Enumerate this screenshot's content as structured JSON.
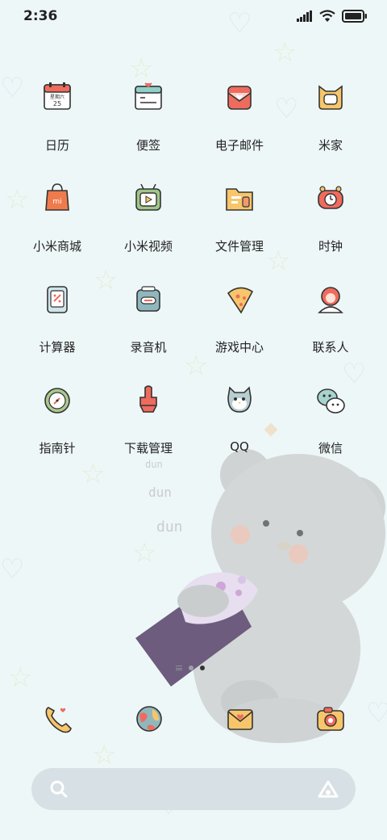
{
  "status_bar": {
    "time": "2:36",
    "icons": [
      "signal-icon",
      "wifi-icon",
      "battery-icon"
    ]
  },
  "apps": [
    {
      "label": "日历",
      "icon": "calendar-icon",
      "calendar_weekday": "星期六",
      "calendar_day": "25"
    },
    {
      "label": "便签",
      "icon": "notes-icon"
    },
    {
      "label": "电子邮件",
      "icon": "email-icon"
    },
    {
      "label": "米家",
      "icon": "mijia-icon"
    },
    {
      "label": "小米商城",
      "icon": "mi-store-icon"
    },
    {
      "label": "小米视频",
      "icon": "mi-video-icon"
    },
    {
      "label": "文件管理",
      "icon": "file-manager-icon"
    },
    {
      "label": "时钟",
      "icon": "clock-icon"
    },
    {
      "label": "计算器",
      "icon": "calculator-icon"
    },
    {
      "label": "录音机",
      "icon": "recorder-icon"
    },
    {
      "label": "游戏中心",
      "icon": "game-center-icon"
    },
    {
      "label": "联系人",
      "icon": "contacts-icon"
    },
    {
      "label": "指南针",
      "icon": "compass-icon"
    },
    {
      "label": "下载管理",
      "icon": "downloads-icon"
    },
    {
      "label": "QQ",
      "icon": "qq-icon"
    },
    {
      "label": "微信",
      "icon": "wechat-icon"
    }
  ],
  "wallpaper_text": [
    "dun",
    "dun",
    "dun"
  ],
  "page_indicator": {
    "pages": 2,
    "current": 2
  },
  "dock": [
    {
      "icon": "phone-icon"
    },
    {
      "icon": "browser-icon"
    },
    {
      "icon": "messages-icon"
    },
    {
      "icon": "camera-icon"
    }
  ],
  "search_bar": {
    "left_icon": "search-icon",
    "right_icon": "assistant-icon"
  },
  "colors": {
    "background": "#eef7f8",
    "search_bar": "#d7e0e4",
    "accent_red": "#ef6b5e",
    "accent_yellow": "#f7c66a"
  }
}
